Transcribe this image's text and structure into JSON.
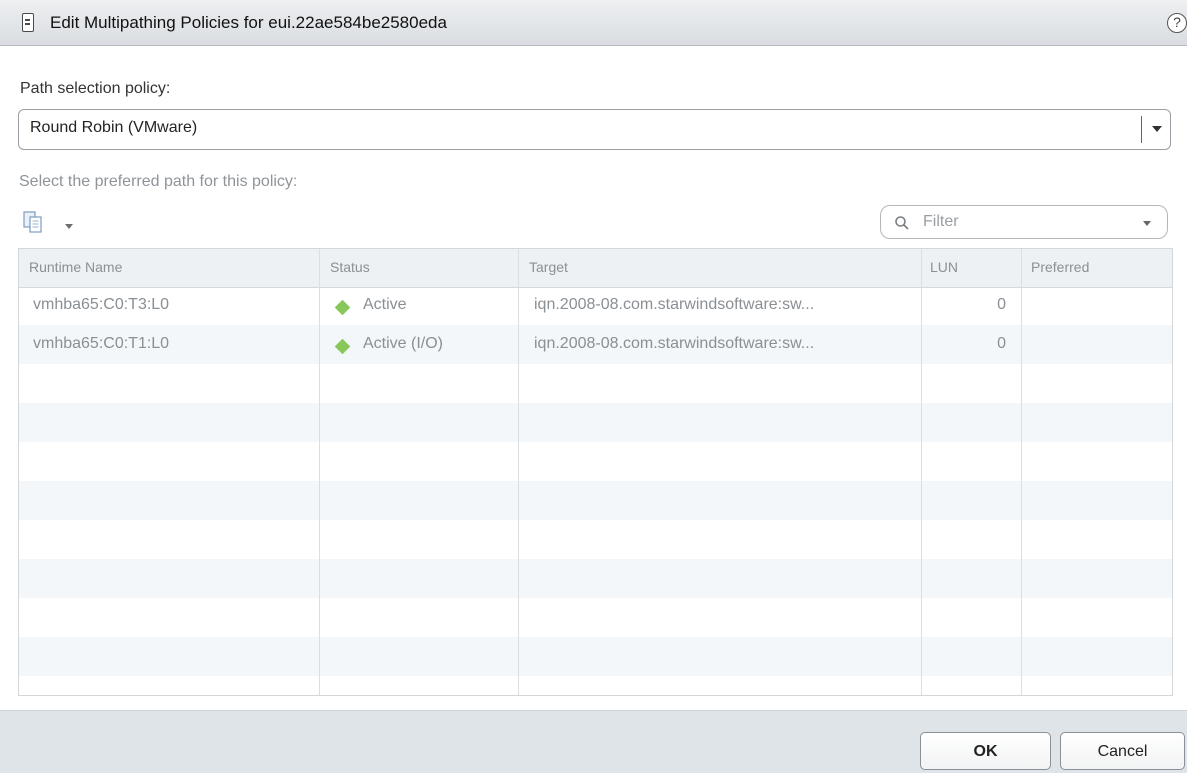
{
  "dialog": {
    "title": "Edit Multipathing Policies for eui.22ae584be2580eda",
    "help": "?"
  },
  "policy": {
    "label": "Path selection policy:",
    "selected": "Round Robin (VMware)"
  },
  "preferred": {
    "label": "Select the preferred path for this policy:"
  },
  "filter": {
    "placeholder": "Filter"
  },
  "table": {
    "columns": [
      "Runtime Name",
      "Status",
      "Target",
      "LUN",
      "Preferred"
    ],
    "rows": [
      {
        "runtime_name": "vmhba65:C0:T3:L0",
        "status": "Active",
        "target": "iqn.2008-08.com.starwindsoftware:sw...",
        "lun": "0",
        "preferred": ""
      },
      {
        "runtime_name": "vmhba65:C0:T1:L0",
        "status": "Active (I/O)",
        "target": "iqn.2008-08.com.starwindsoftware:sw...",
        "lun": "0",
        "preferred": ""
      }
    ]
  },
  "buttons": {
    "ok": "OK",
    "cancel": "Cancel"
  },
  "colors": {
    "status_active": "#88c75a",
    "footer_bg": "#dfe4e8"
  },
  "icons": {
    "title": "device-icon",
    "help": "help-icon",
    "export": "export-icon",
    "filter": "search-icon",
    "status": "diamond-icon"
  }
}
